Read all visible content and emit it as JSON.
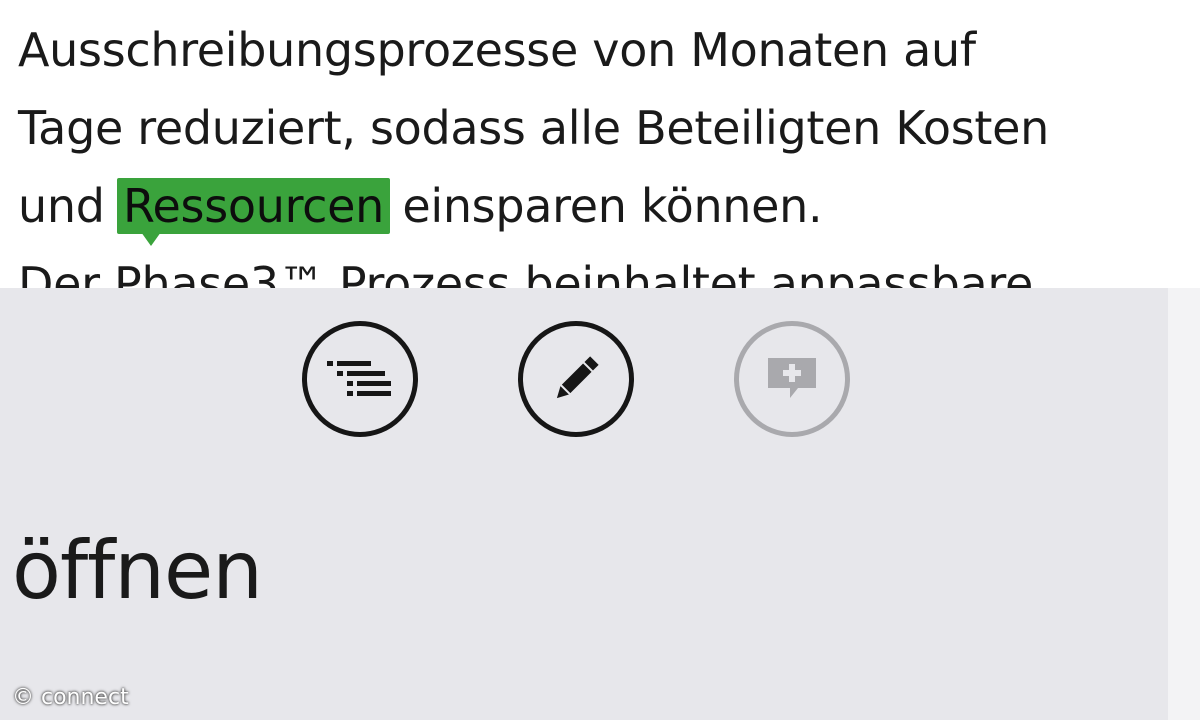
{
  "document": {
    "lines": [
      "Ausschreibungsprozesse von Monaten auf",
      "Tage reduziert, sodass alle Beteiligten Kosten",
      "und",
      "Der Phase3™ Prozess beinhaltet anpassbare"
    ],
    "highlighted_word": "Ressourcen",
    "line3_rest": "einsparen können.",
    "highlight_color": "#3aa33c"
  },
  "app_bar": {
    "background": "#e7e7eb",
    "buttons": [
      {
        "icon": "outline-list-icon",
        "enabled": true
      },
      {
        "icon": "pencil-edit-icon",
        "enabled": true
      },
      {
        "icon": "add-comment-icon",
        "enabled": false
      }
    ],
    "label": "öffnen"
  },
  "watermark": "© connect"
}
